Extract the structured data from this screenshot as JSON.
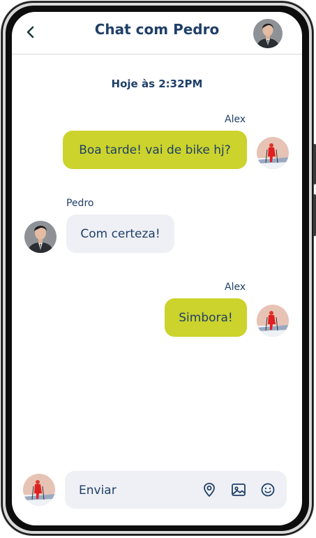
{
  "header": {
    "title": "Chat com Pedro"
  },
  "chat": {
    "timestamp": "Hoje às 2:32PM",
    "messages": [
      {
        "sender": "Alex",
        "text": "Boa tarde! vai de bike hj?",
        "direction": "outgoing"
      },
      {
        "sender": "Pedro",
        "text": "Com certeza!",
        "direction": "incoming"
      },
      {
        "sender": "Alex",
        "text": "Simbora!",
        "direction": "outgoing"
      }
    ]
  },
  "composer": {
    "placeholder": "Enviar",
    "icons": [
      "location-pin-icon",
      "image-icon",
      "emoji-icon"
    ]
  },
  "colors": {
    "accent": "#cbd32c",
    "text": "#1f3f68",
    "incoming_bubble": "#eef0f5"
  }
}
